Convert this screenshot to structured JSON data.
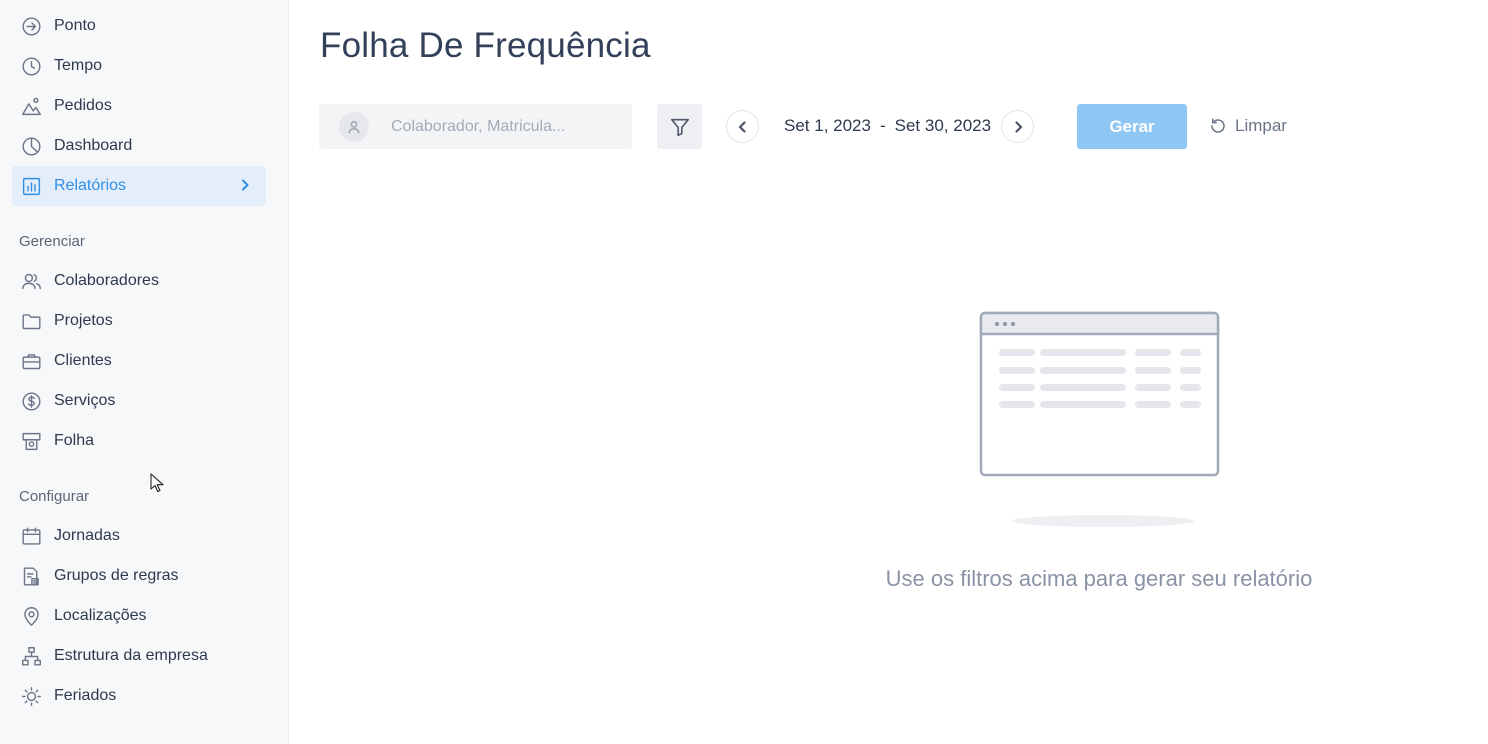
{
  "sidebar": {
    "top_items": [
      {
        "label": "Ponto",
        "icon": "arrow-right-circle-icon"
      },
      {
        "label": "Tempo",
        "icon": "clock-icon"
      },
      {
        "label": "Pedidos",
        "icon": "mountain-icon"
      },
      {
        "label": "Dashboard",
        "icon": "pie-chart-icon"
      },
      {
        "label": "Relatórios",
        "icon": "bar-chart-icon",
        "active": true
      }
    ],
    "gerenciar_title": "Gerenciar",
    "gerenciar_items": [
      {
        "label": "Colaboradores",
        "icon": "users-icon"
      },
      {
        "label": "Projetos",
        "icon": "folder-icon"
      },
      {
        "label": "Clientes",
        "icon": "briefcase-icon"
      },
      {
        "label": "Serviços",
        "icon": "dollar-circle-icon"
      },
      {
        "label": "Folha",
        "icon": "payroll-icon"
      }
    ],
    "configurar_title": "Configurar",
    "configurar_items": [
      {
        "label": "Jornadas",
        "icon": "calendar-icon"
      },
      {
        "label": "Grupos de regras",
        "icon": "rules-document-icon"
      },
      {
        "label": "Localizações",
        "icon": "map-pin-icon"
      },
      {
        "label": "Estrutura da empresa",
        "icon": "org-chart-icon"
      },
      {
        "label": "Feriados",
        "icon": "sun-icon"
      }
    ]
  },
  "main": {
    "title": "Folha De Frequência",
    "search_placeholder": "Colaborador, Matricula...",
    "date_start": "Set 1, 2023",
    "date_sep": "-",
    "date_end": "Set 30, 2023",
    "generate_label": "Gerar",
    "clear_label": "Limpar",
    "empty_message": "Use os filtros acima para gerar seu relatório"
  },
  "colors": {
    "accent": "#2f8fe6",
    "active_bg": "#e4eefb",
    "generate_btn": "#8fc7f4"
  }
}
